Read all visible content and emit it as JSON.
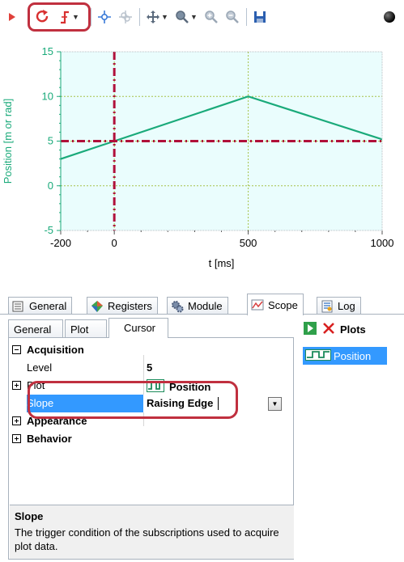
{
  "toolbar": {
    "items": [
      "play-icon",
      "refresh-icon",
      "trigger-icon",
      "crosshair-icon",
      "multi-cursor-icon",
      "pan-icon",
      "zoom-icon",
      "zoom-in-icon",
      "zoom-out-icon",
      "save-icon",
      "status-dot-icon"
    ],
    "highlight_color": "#c0303f"
  },
  "chart_data": {
    "type": "line",
    "xlabel": "t [ms]",
    "ylabel": "Position [m or rad]",
    "xlim": [
      -200,
      1000
    ],
    "ylim": [
      -5,
      15
    ],
    "xticks": [
      "-200",
      "0",
      "500",
      "1000"
    ],
    "yticks": [
      "-5",
      "0",
      "5",
      "10",
      "15"
    ],
    "grid": true,
    "background": "#eafdfd",
    "series": [
      {
        "name": "Position",
        "color": "#1aaa7a",
        "x": [
          -200,
          500,
          1000
        ],
        "y": [
          3,
          10,
          5.2
        ]
      }
    ],
    "cursors": {
      "trigger_time": 0,
      "trigger_level": 5,
      "color": "#b0103a"
    }
  },
  "tabs": [
    {
      "label": "General",
      "icon": "list-icon"
    },
    {
      "label": "Registers",
      "icon": "gem-icon"
    },
    {
      "label": "Module",
      "icon": "gears-icon"
    },
    {
      "label": "Scope",
      "icon": "chart-icon",
      "active": true
    },
    {
      "label": "Log",
      "icon": "log-icon"
    }
  ],
  "subtabs": [
    {
      "label": "General"
    },
    {
      "label": "Plot"
    },
    {
      "label": "Cursor",
      "active": true
    }
  ],
  "grid": {
    "acquisition_label": "Acquisition",
    "level_label": "Level",
    "level_value": "5",
    "plot_label": "Plot",
    "plot_value": "Position",
    "slope_label": "Slope",
    "slope_value": "Raising Edge",
    "appearance_label": "Appearance",
    "behavior_label": "Behavior"
  },
  "description": {
    "title": "Slope",
    "text": "The trigger condition of the subscriptions used to acquire plot data."
  },
  "plots_panel": {
    "title": "Plots",
    "items": [
      "Position"
    ]
  },
  "colors": {
    "accent_select": "#3399ff",
    "plot_line": "#1aaa7a",
    "cursor": "#b0103a"
  }
}
